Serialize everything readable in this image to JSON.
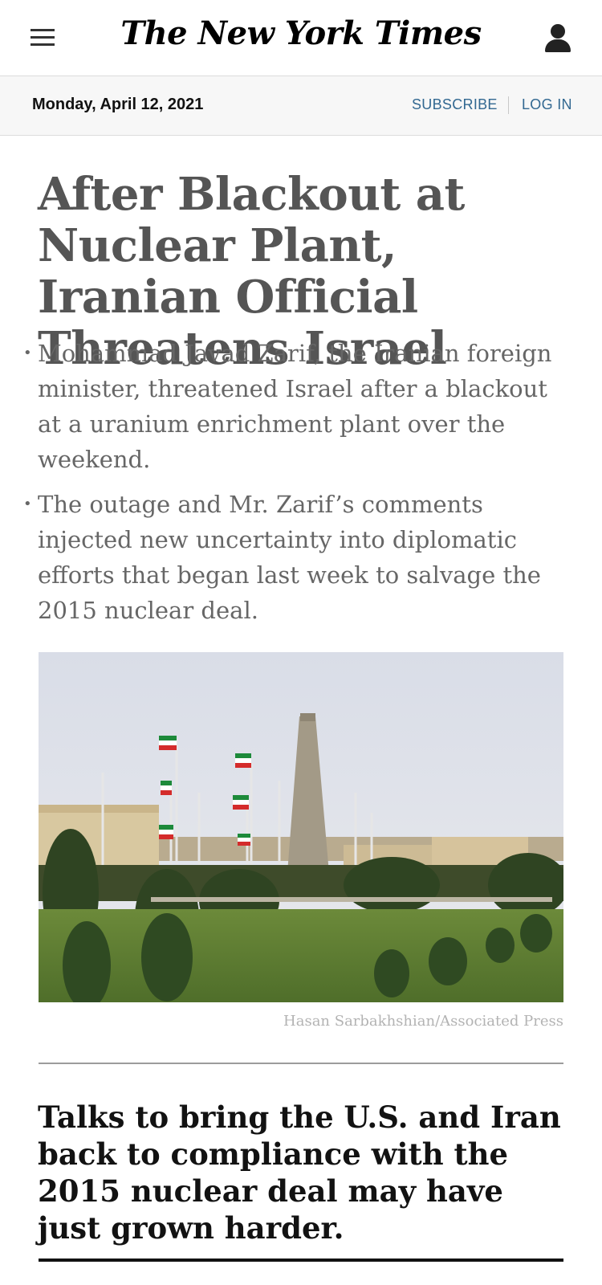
{
  "header": {
    "logo": "The New York Times"
  },
  "datebar": {
    "date": "Monday, April 12, 2021",
    "subscribe": "SUBSCRIBE",
    "login": "LOG IN"
  },
  "article": {
    "headline": "After Blackout at Nuclear Plant, Iranian Official Threatens Israel",
    "bullets": [
      "Mohammad Javad Zarif, the Iranian foreign minister, threatened Israel after a blackout at a uranium enrichment plant over the weekend.",
      "The outage and Mr. Zarif’s comments injected new uncertainty into diplomatic efforts that began last week to salvage the 2015 nuclear deal."
    ],
    "photo_credit": "Hasan Sarbakhshian/Associated Press",
    "summary": "Talks to bring the U.S. and Iran back to compliance with the 2015 nuclear deal may have just grown harder."
  },
  "colors": {
    "link": "#326891",
    "headline": "#555555",
    "body": "#666666"
  },
  "icons": {
    "menu": "hamburger-menu-icon",
    "account": "user-account-icon"
  }
}
